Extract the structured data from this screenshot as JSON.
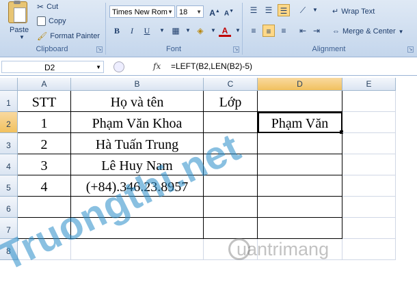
{
  "ribbon": {
    "clipboard": {
      "label": "Clipboard",
      "paste": "Paste",
      "cut": "Cut",
      "copy": "Copy",
      "format_painter": "Format Painter"
    },
    "font": {
      "label": "Font",
      "font_name": "Times New Rom",
      "font_size": "18",
      "bold": "B",
      "italic": "I",
      "underline": "U",
      "font_color_letter": "A",
      "grow": "A",
      "shrink": "A"
    },
    "alignment": {
      "label": "Alignment",
      "wrap_text": "Wrap Text",
      "merge_center": "Merge & Center"
    }
  },
  "formula_bar": {
    "name_box": "D2",
    "fx": "fx",
    "formula": "=LEFT(B2,LEN(B2)-5)"
  },
  "columns": [
    "A",
    "B",
    "C",
    "D",
    "E"
  ],
  "rows": [
    "1",
    "2",
    "3",
    "4",
    "5",
    "6",
    "7",
    "8"
  ],
  "cells": {
    "A1": "STT",
    "B1": "Họ và tên",
    "C1": "Lớp",
    "A2": "1",
    "B2": "Phạm Văn Khoa",
    "D2": "Phạm Văn",
    "A3": "2",
    "B3": "Hà Tuấn Trung",
    "A4": "3",
    "B4": "Lê Huy Nam",
    "A5": "4",
    "B5": "(+84).346.23.8957"
  },
  "watermark": {
    "primary": "Truongthi.net",
    "secondary": "uantrimang"
  },
  "colors": {
    "ribbon": "#c4d6ec",
    "header_selected": "#f1c15f",
    "watermark": "#288cc8"
  }
}
